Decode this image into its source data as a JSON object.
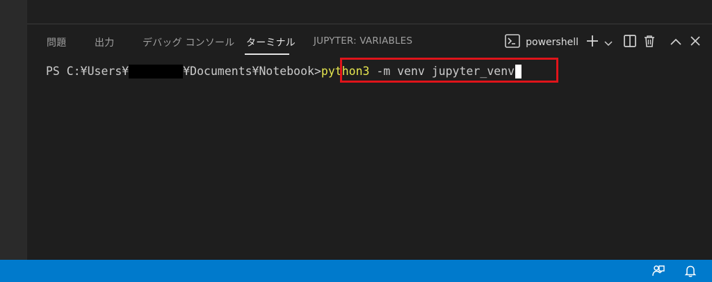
{
  "panel": {
    "tabs": [
      {
        "label": "問題"
      },
      {
        "label": "出力"
      },
      {
        "label": "デバッグ コンソール"
      },
      {
        "label": "ターミナル"
      },
      {
        "label": "JUPYTER: VARIABLES"
      }
    ],
    "active_tab": "ターミナル"
  },
  "terminal_profile": {
    "name": "powershell"
  },
  "terminal": {
    "prompt_prefix": "PS C:¥Users¥",
    "prompt_suffix": "¥Documents¥Notebook>",
    "command_keyword": "python3",
    "command_rest": " -m venv jupyter_venv"
  },
  "icons": {
    "terminal_profile": "terminal-icon",
    "new_terminal": "plus-icon",
    "dropdown": "chevron-down-icon",
    "split": "split-editor-icon",
    "delete": "trash-icon",
    "maximize": "chevron-up-icon",
    "close": "close-icon",
    "feedback": "feedback-icon",
    "notifications": "bell-icon"
  },
  "colors": {
    "status_bar": "#007acc",
    "highlight": "#e0141a",
    "command_keyword": "#e5e54f"
  }
}
